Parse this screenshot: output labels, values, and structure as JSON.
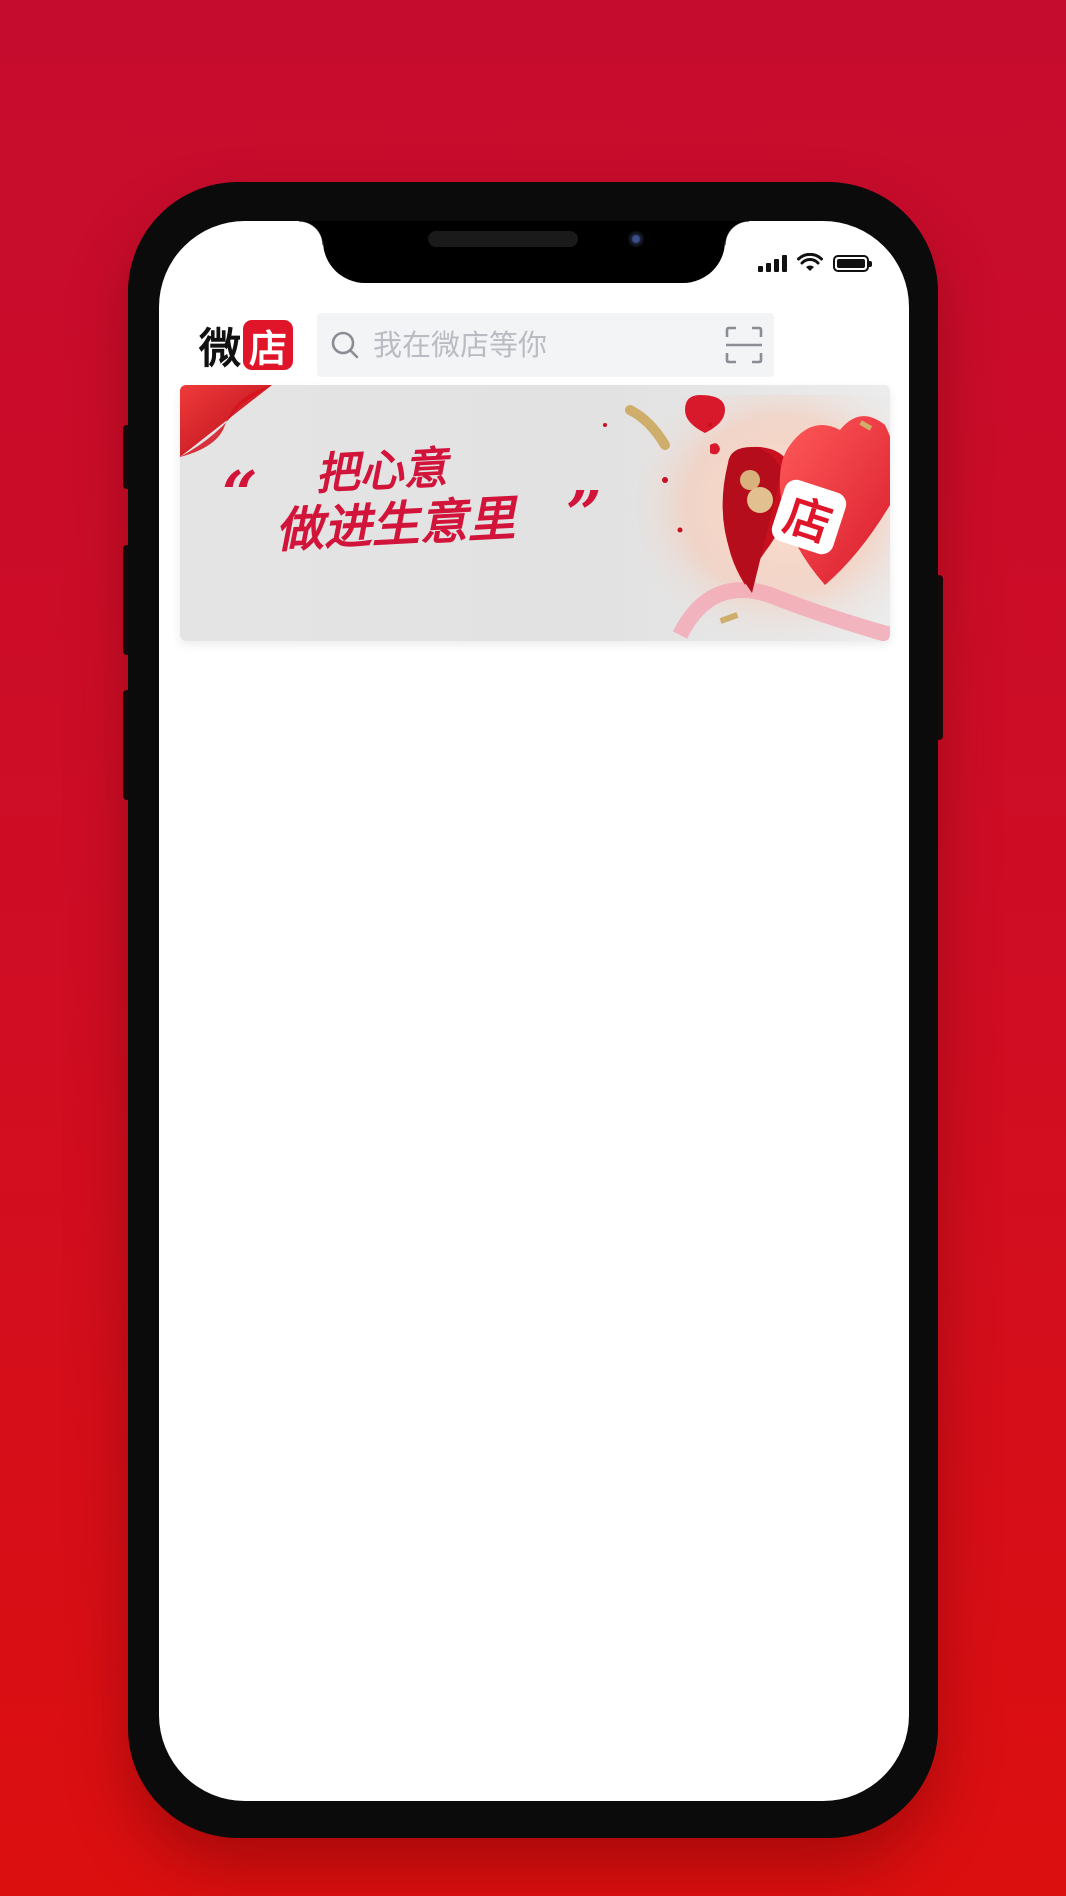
{
  "status_bar": {
    "icons": [
      "signal-icon",
      "wifi-icon",
      "battery-icon"
    ]
  },
  "header": {
    "logo_wei": "微",
    "logo_dian": "店",
    "search": {
      "placeholder": "我在微店等你",
      "value": ""
    },
    "icons": [
      "search-icon",
      "scan-icon"
    ]
  },
  "banner": {
    "quote_open": "“",
    "line1": "把心意",
    "line2": "做进生意里",
    "quote_close": "”",
    "badge": "店"
  },
  "colors": {
    "background_top": "#c60c2e",
    "background_bottom": "#dc0f0f",
    "brand_red": "#e0152a",
    "banner_text": "#d2143a"
  }
}
